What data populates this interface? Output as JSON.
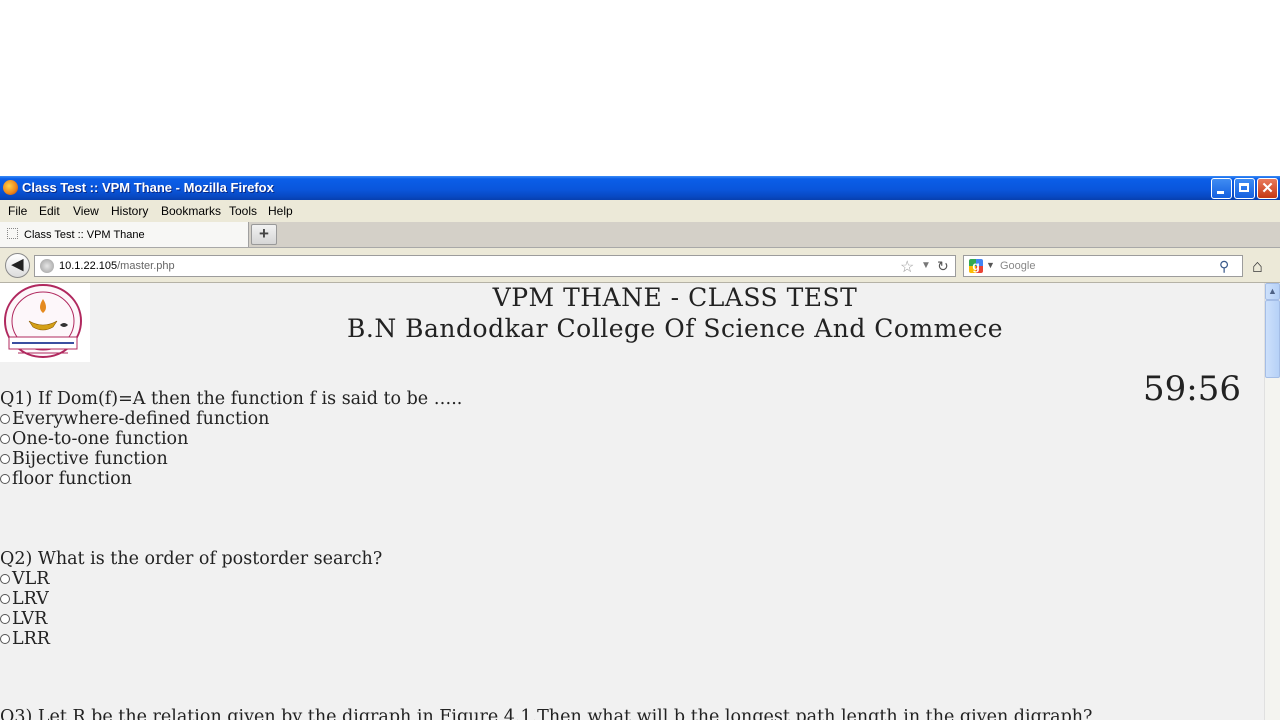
{
  "window": {
    "title": "Class Test :: VPM Thane - Mozilla Firefox"
  },
  "menu": [
    "File",
    "Edit",
    "View",
    "History",
    "Bookmarks",
    "Tools",
    "Help"
  ],
  "tab": {
    "label": "Class Test :: VPM Thane",
    "new_tab_symbol": "+"
  },
  "nav": {
    "url_host": "10.1.22.105",
    "url_path": "/master.php",
    "search_placeholder": "Google"
  },
  "page": {
    "title": "VPM THANE - CLASS TEST",
    "college": "B.N Bandodkar College Of Science And Commece",
    "timer": "59:56",
    "logo_text": "विद्या प्रसारक मंडळ"
  },
  "questions": [
    {
      "text": "Q1) If Dom(f)=A then the function f is said to be …..",
      "options": [
        "Everywhere-defined function",
        "One-to-one function",
        "Bijective function",
        "floor function"
      ]
    },
    {
      "text": "Q2) What is the order of postorder search?",
      "options": [
        "VLR",
        "LRV",
        "LVR",
        "LRR"
      ]
    },
    {
      "text": "Q3) Let R be the relation given by the digraph in Figure 4.1.Then what will b the longest path length in the given digraph?",
      "options": []
    }
  ],
  "icons": {
    "back": "back-arrow-icon",
    "reload": "reload-icon",
    "bookmark": "star-icon",
    "search": "magnifier-icon",
    "home": "home-icon"
  }
}
